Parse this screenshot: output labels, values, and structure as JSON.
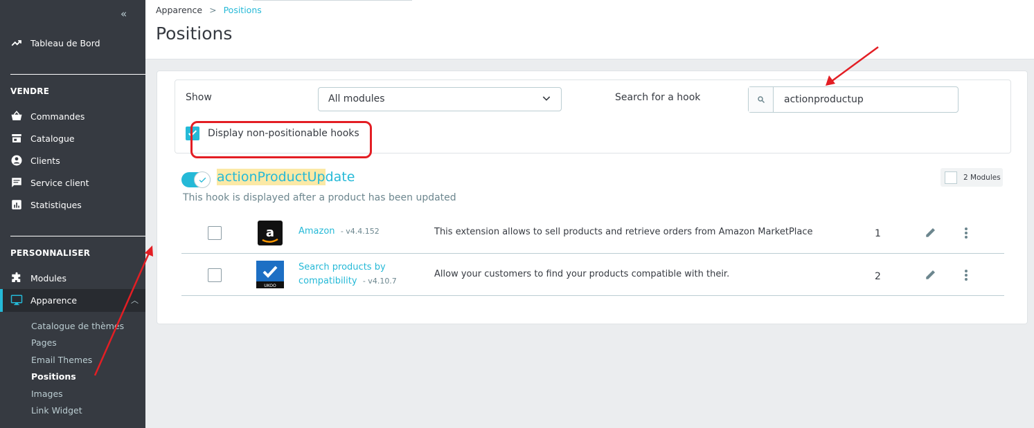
{
  "sidebar": {
    "collapse_glyph": "«",
    "dashboard": "Tableau de Bord",
    "sell_title": "VENDRE",
    "sell_items": [
      "Commandes",
      "Catalogue",
      "Clients",
      "Service client",
      "Statistiques"
    ],
    "customize_title": "PERSONNALISER",
    "modules": "Modules",
    "appearance": "Apparence",
    "sub_items": [
      "Catalogue de thèmes",
      "Pages",
      "Email Themes",
      "Positions",
      "Images",
      "Link Widget"
    ],
    "current_sub": "Positions"
  },
  "header": {
    "breadcrumb_parent": "Apparence",
    "breadcrumb_sep": ">",
    "breadcrumb_current": "Positions",
    "title": "Positions"
  },
  "filters": {
    "show_label": "Show",
    "show_value": "All modules",
    "search_label": "Search for a hook",
    "search_value": "actionproductup",
    "non_positionable_label": "Display non-positionable hooks",
    "non_positionable_checked": true
  },
  "hook": {
    "name_highlighted": "actionProductUp",
    "name_rest": "date",
    "description": "This hook is displayed after a product has been updated",
    "modules_count": "2 Modules",
    "enabled": true
  },
  "modules": [
    {
      "name": "Amazon",
      "version": "- v4.4.152",
      "description": "This extension allows to sell products and retrieve orders from Amazon MarketPlace",
      "position": "1",
      "logo": "amazon-logo"
    },
    {
      "name_line1": "Search products by",
      "name_line2": "compatibility",
      "version": "- v4.10.7",
      "description": "Allow your customers to find your products compatible with their.",
      "position": "2",
      "logo": "ukoo-logo"
    }
  ],
  "colors": {
    "accent": "#25b9d7",
    "sidebar": "#363a41",
    "annotation_red": "#e31e24",
    "highlight": "#fbe9a6"
  }
}
